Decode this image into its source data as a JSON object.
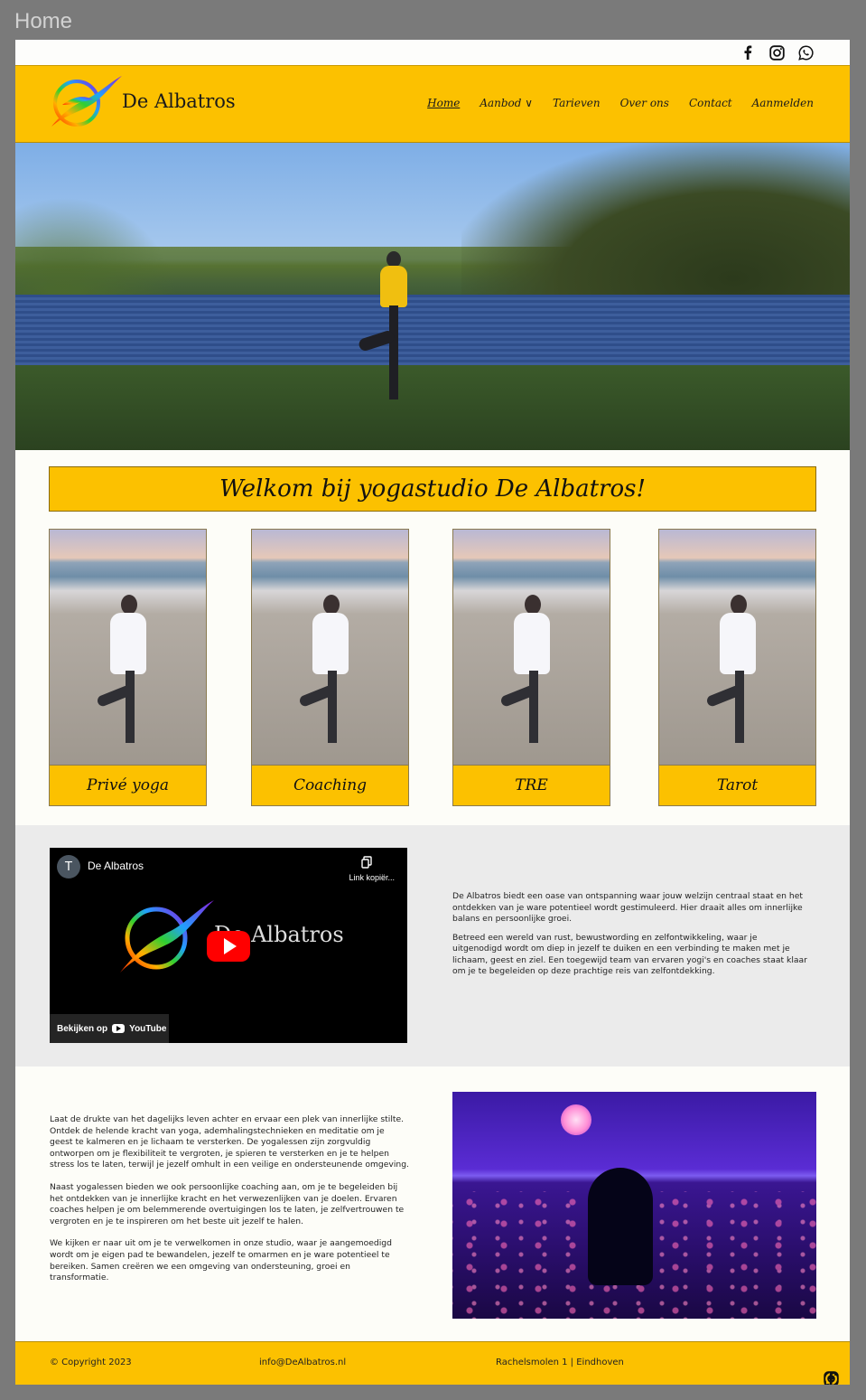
{
  "window": {
    "title": "Home"
  },
  "header": {
    "brand": "De Albatros",
    "nav": [
      {
        "label": "Home",
        "active": true
      },
      {
        "label": "Aanbod  ∨",
        "active": false
      },
      {
        "label": "Tarieven",
        "active": false
      },
      {
        "label": "Over ons",
        "active": false
      },
      {
        "label": "Contact",
        "active": false
      },
      {
        "label": "Aanmelden",
        "active": false
      }
    ],
    "social_icons": [
      "facebook-icon",
      "instagram-icon",
      "whatsapp-icon"
    ]
  },
  "welcome": {
    "heading": "Welkom bij yogastudio De Albatros!"
  },
  "cards": [
    {
      "label": "Privé yoga"
    },
    {
      "label": "Coaching"
    },
    {
      "label": "TRE"
    },
    {
      "label": "Tarot"
    }
  ],
  "video": {
    "avatar_letter": "T",
    "channel": "De Albatros",
    "copy_link": "Link kopiër...",
    "title": "De Albatros",
    "watch_on": "Bekijken op",
    "platform": "YouTube"
  },
  "intro": {
    "paragraphs": [
      "De Albatros biedt een oase van ontspanning waar jouw welzijn centraal staat en het ontdekken van je ware potentieel wordt gestimuleerd. Hier draait alles om innerlijke balans en persoonlijke groei.",
      "Betreed een wereld van rust, bewustwording en zelfontwikkeling, waar je uitgenodigd wordt om diep in jezelf te duiken en een verbinding te maken met je lichaam, geest en ziel. Een toegewijd team van ervaren yogi's en coaches staat klaar om je te begeleiden op deze prachtige reis van zelfontdekking."
    ]
  },
  "about": {
    "paragraphs": [
      "Laat de drukte van het dagelijks leven achter en ervaar een plek van innerlijke stilte. Ontdek de helende kracht van yoga, ademhalingstechnieken en meditatie om je geest te kalmeren en je lichaam te versterken. De yogalessen zijn zorgvuldig ontworpen om je flexibiliteit te vergroten, je spieren te versterken en je te helpen stress los te laten, terwijl je jezelf omhult in een veilige en ondersteunende omgeving.",
      "Naast yogalessen bieden we ook persoonlijke coaching aan, om je te begeleiden bij het ontdekken van je innerlijke kracht en het verwezenlijken van je doelen. Ervaren coaches helpen je om belemmerende overtuigingen los te laten, je zelfvertrouwen te vergroten en je te inspireren om het beste uit jezelf te halen.",
      "We kijken er naar uit om je te verwelkomen in onze studio, waar je aangemoedigd wordt om je eigen pad te bewandelen, jezelf te omarmen en je ware potentieel te bereiken. Samen creëren we een omgeving van ondersteuning, groei en transformatie."
    ]
  },
  "footer": {
    "copyright": "© Copyright 2023",
    "email": "info@DeAlbatros.nl",
    "address": "Rachelsmolen 1 | Eindhoven"
  },
  "colors": {
    "accent": "#fcc100",
    "page_bg": "#fdfdf8",
    "band_bg": "#ebebeb"
  }
}
